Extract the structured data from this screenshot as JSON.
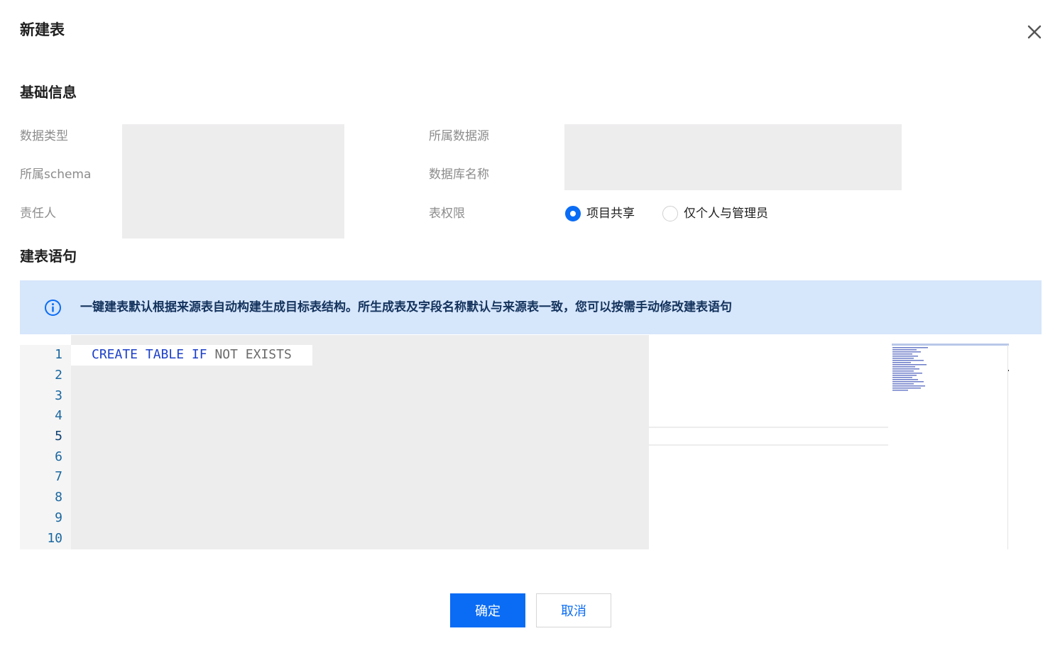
{
  "dialog": {
    "title": "新建表",
    "close_icon": "close-icon"
  },
  "basic_info": {
    "title": "基础信息",
    "labels": {
      "data_type": "数据类型",
      "schema": "所属schema",
      "owner": "责任人",
      "datasource": "所属数据源",
      "database": "数据库名称",
      "permission": "表权限"
    },
    "permission_options": [
      {
        "label": "项目共享",
        "checked": true
      },
      {
        "label": "仅个人与管理员",
        "checked": false
      }
    ]
  },
  "statement": {
    "title": "建表语句",
    "notice": "一键建表默认根据来源表自动构建生成目标表结构。所生成表及字段名称默认与来源表一致，您可以按需手动修改建表语句",
    "notice_icon": "info-icon",
    "line_numbers": [
      "1",
      "2",
      "3",
      "4",
      "5",
      "6",
      "7",
      "8",
      "9",
      "10"
    ],
    "code_tokens": [
      "CREATE",
      "TABLE",
      "IF",
      "NOT",
      "EXISTS"
    ]
  },
  "footer": {
    "confirm_label": "确定",
    "cancel_label": "取消"
  },
  "colors": {
    "primary": "#0a6cf5",
    "notice_bg": "#d6e6fb",
    "masked": "#eeedee"
  }
}
